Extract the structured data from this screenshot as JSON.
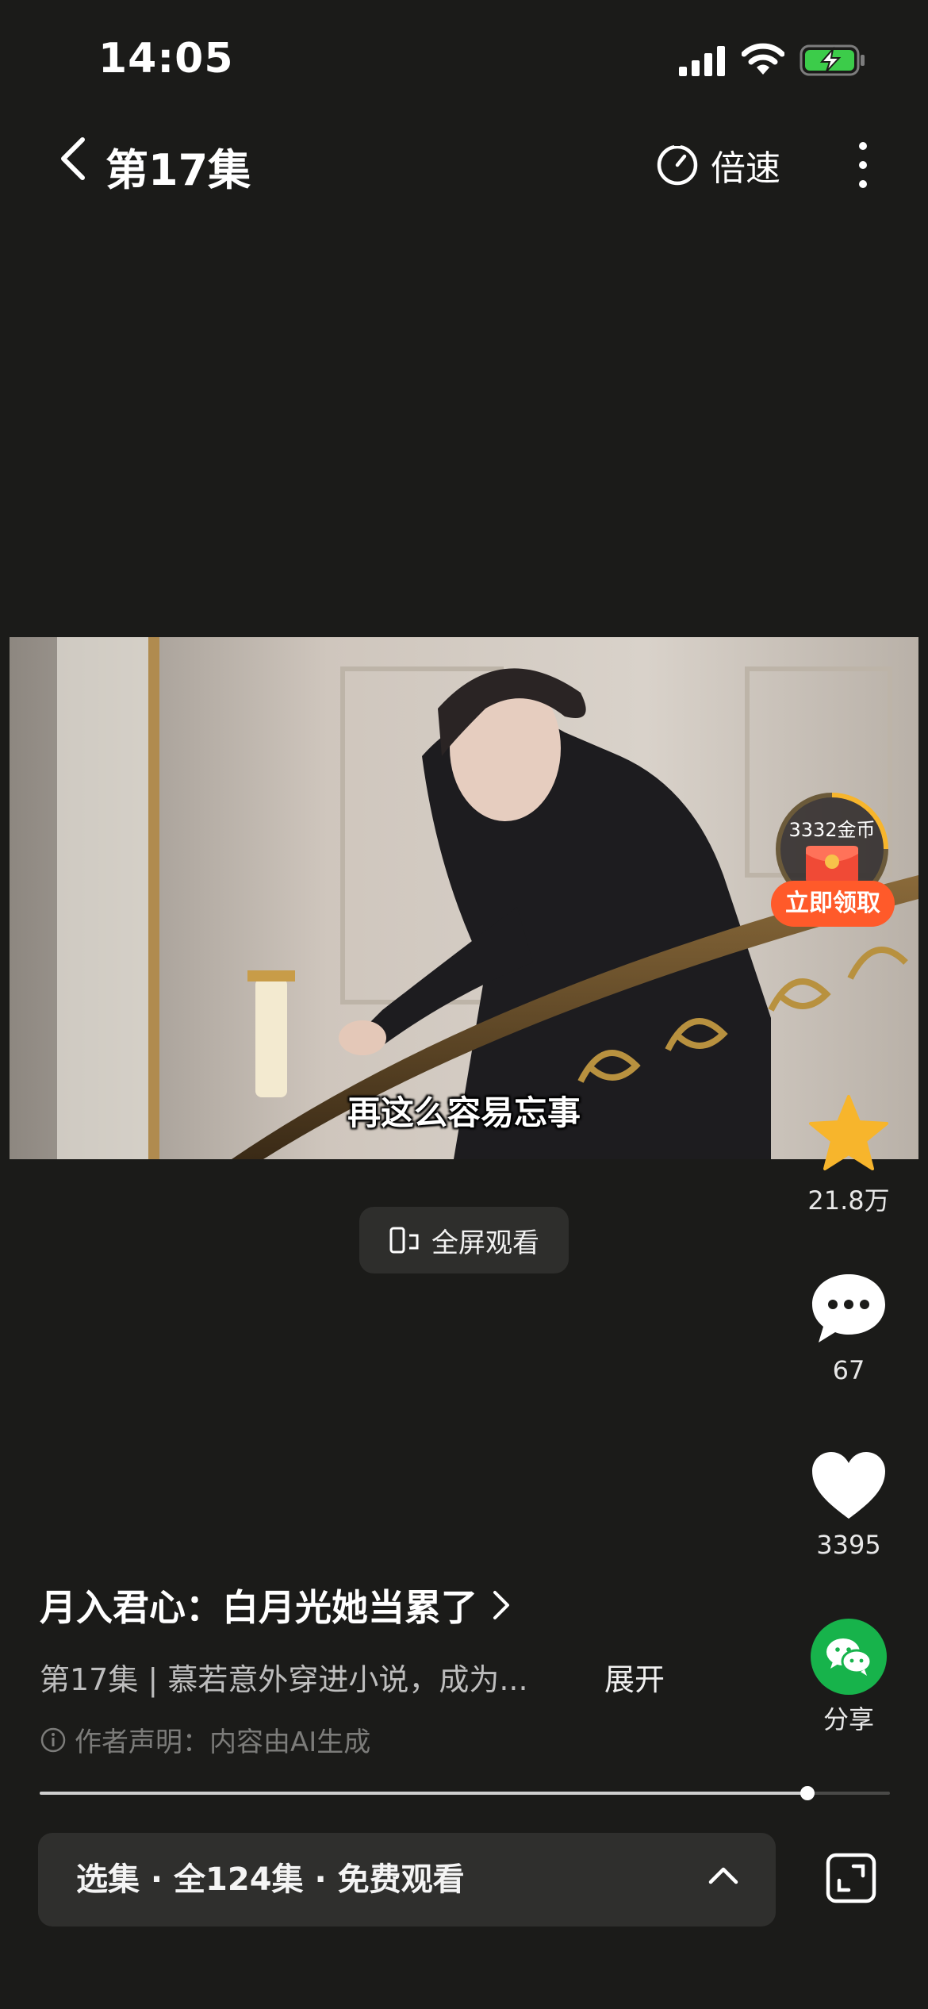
{
  "status_bar": {
    "time": "14:05"
  },
  "nav": {
    "episode_title": "第17集",
    "speed_label": "倍速"
  },
  "video": {
    "subtitle": "再这么容易忘事",
    "coin_reward": {
      "amount_label": "3332金币",
      "claim_label": "立即领取"
    }
  },
  "fullscreen": {
    "label": "全屏观看"
  },
  "rail": {
    "collect_count": "21.8万",
    "comment_count": "67",
    "like_count": "3395",
    "share_label": "分享"
  },
  "info": {
    "drama_title": "月入君心：白月光她当累了",
    "episode_desc": "第17集 | 慕若意外穿进小说，成为...",
    "expand_label": "展开",
    "ai_note": "作者声明：内容由AI生成"
  },
  "progress": {
    "fraction": 0.903
  },
  "bottom_bar": {
    "selector_label": "选集 · 全124集 · 免费观看"
  },
  "colors": {
    "accent_star": "#f7b52c",
    "share_green": "#17b34b",
    "claim_orange": "#ff5a2a",
    "battery_green": "#3ccc4a"
  }
}
